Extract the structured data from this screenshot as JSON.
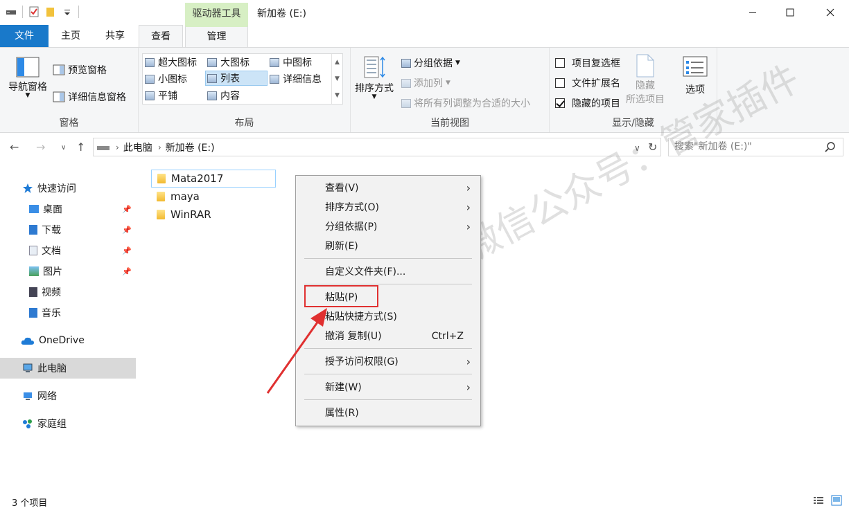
{
  "window": {
    "title": "新加卷 (E:)",
    "context_tab_group": "驱动器工具"
  },
  "tabs": [
    {
      "label": "文件"
    },
    {
      "label": "主页"
    },
    {
      "label": "共享"
    },
    {
      "label": "查看"
    },
    {
      "label": "管理"
    }
  ],
  "ribbon": {
    "panes": {
      "label": "窗格",
      "nav_pane": "导航窗格",
      "preview_pane": "预览窗格",
      "details_pane": "详细信息窗格"
    },
    "layout": {
      "label": "布局",
      "items": [
        "超大图标",
        "大图标",
        "中图标",
        "小图标",
        "列表",
        "详细信息",
        "平铺",
        "内容"
      ],
      "selected": "列表"
    },
    "current_view": {
      "label": "当前视图",
      "sort_by": "排序方式",
      "group_by": "分组依据",
      "add_column": "添加列",
      "size_all": "将所有列调整为合适的大小"
    },
    "show_hide": {
      "label": "显示/隐藏",
      "item_checkboxes": "项目复选框",
      "file_extensions": "文件扩展名",
      "hidden_items": "隐藏的项目",
      "hide_line1": "隐藏",
      "hide_line2": "所选项目",
      "options": "选项"
    }
  },
  "address": {
    "crumbs": [
      "此电脑",
      "新加卷 (E:)"
    ],
    "search_placeholder": "搜索\"新加卷 (E:)\""
  },
  "sidebar": {
    "quick_access": "快速访问",
    "pinned": [
      "桌面",
      "下载",
      "文档",
      "图片"
    ],
    "others": [
      "视频",
      "音乐"
    ],
    "onedrive": "OneDrive",
    "this_pc": "此电脑",
    "network": "网络",
    "homegroup": "家庭组"
  },
  "files": [
    "Mata2017",
    "maya",
    "WinRAR"
  ],
  "context_menu": {
    "view": "查看(V)",
    "sort": "排序方式(O)",
    "group": "分组依据(P)",
    "refresh": "刷新(E)",
    "customize": "自定义文件夹(F)...",
    "paste": "粘贴(P)",
    "paste_shortcut": "粘贴快捷方式(S)",
    "undo": "撤消 复制(U)",
    "undo_shortcut": "Ctrl+Z",
    "grant_access": "授予访问权限(G)",
    "new": "新建(W)",
    "properties": "属性(R)"
  },
  "watermark": "微信公众号：管家插件",
  "status": {
    "item_count": "3 个项目"
  },
  "colors": {
    "file_tab": "#1979ca",
    "context_tab": "#d7efc4",
    "highlight_box": "#e03030",
    "arrow": "#e03030"
  }
}
